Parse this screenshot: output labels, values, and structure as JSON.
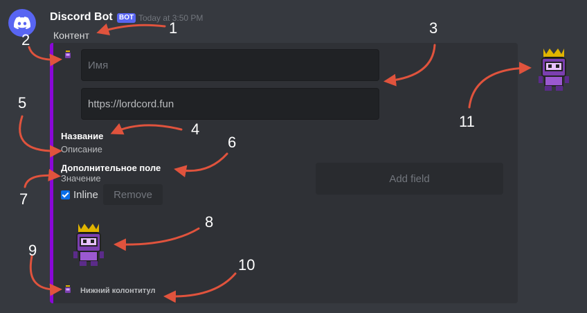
{
  "message": {
    "username": "Discord Bot",
    "bot_tag": "BOT",
    "timestamp": "Today at 3:50 PM",
    "content": "Контент"
  },
  "embed": {
    "color": "#8a07d8",
    "author_name_placeholder": "Имя",
    "author_url": "https://lordcord.fun",
    "title": "Название",
    "description": "Описание",
    "field": {
      "name": "Дополнительное поле",
      "value": "Значение",
      "inline_label": "Inline",
      "inline_checked": true,
      "remove_label": "Remove"
    },
    "add_field_label": "Add field",
    "footer_text": "Нижний колонтитул"
  },
  "annotations": [
    "1",
    "2",
    "3",
    "4",
    "5",
    "6",
    "7",
    "8",
    "9",
    "10",
    "11"
  ],
  "icons": {
    "avatar": "discord-logo-icon",
    "author": "robot-king-icon",
    "image": "robot-king-icon",
    "thumbnail": "robot-king-icon",
    "footer": "robot-king-icon"
  }
}
